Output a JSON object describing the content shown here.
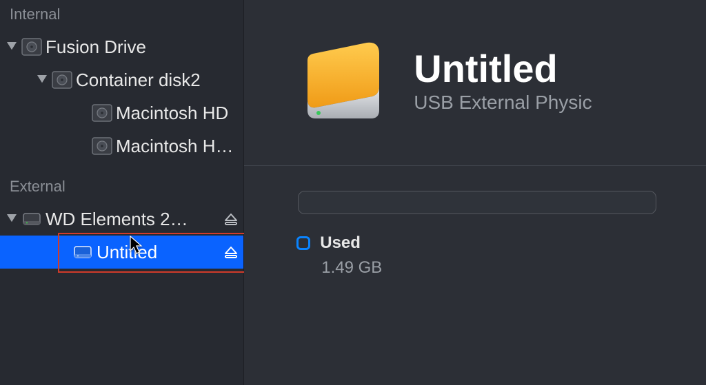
{
  "sidebar": {
    "sections": {
      "internal": {
        "header": "Internal",
        "items": [
          {
            "label": "Fusion Drive"
          },
          {
            "label": "Container disk2"
          },
          {
            "label": "Macintosh HD"
          },
          {
            "label": "Macintosh H…"
          }
        ]
      },
      "external": {
        "header": "External",
        "items": [
          {
            "label": "WD Elements 2…"
          },
          {
            "label": "Untitled"
          }
        ]
      }
    }
  },
  "main": {
    "title": "Untitled",
    "subtitle": "USB External Physic",
    "usage": {
      "used_label": "Used",
      "used_value": "1.49 GB"
    }
  }
}
